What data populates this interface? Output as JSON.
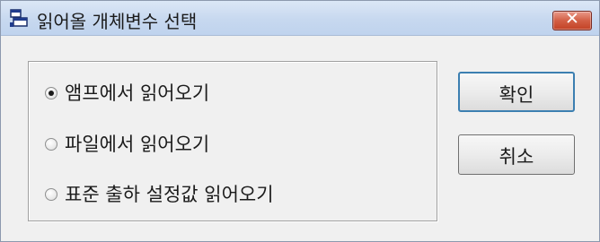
{
  "window": {
    "title": "읽어올 개체변수 선택",
    "close_label": "✕"
  },
  "options": {
    "items": [
      {
        "label": "앰프에서 읽어오기",
        "selected": true
      },
      {
        "label": "파일에서 읽어오기",
        "selected": false
      },
      {
        "label": "표준 출하 설정값 읽어오기",
        "selected": false
      }
    ]
  },
  "buttons": {
    "ok_label": "확인",
    "cancel_label": "취소"
  },
  "colors": {
    "titlebar": "#c7d8ef",
    "close_button": "#c24125",
    "dialog_background": "#f0f0f0",
    "default_button_border": "#3c7fb1"
  },
  "icons": {
    "title": "application-window-icon",
    "close": "close-icon",
    "radio": "radio-button-icon"
  }
}
